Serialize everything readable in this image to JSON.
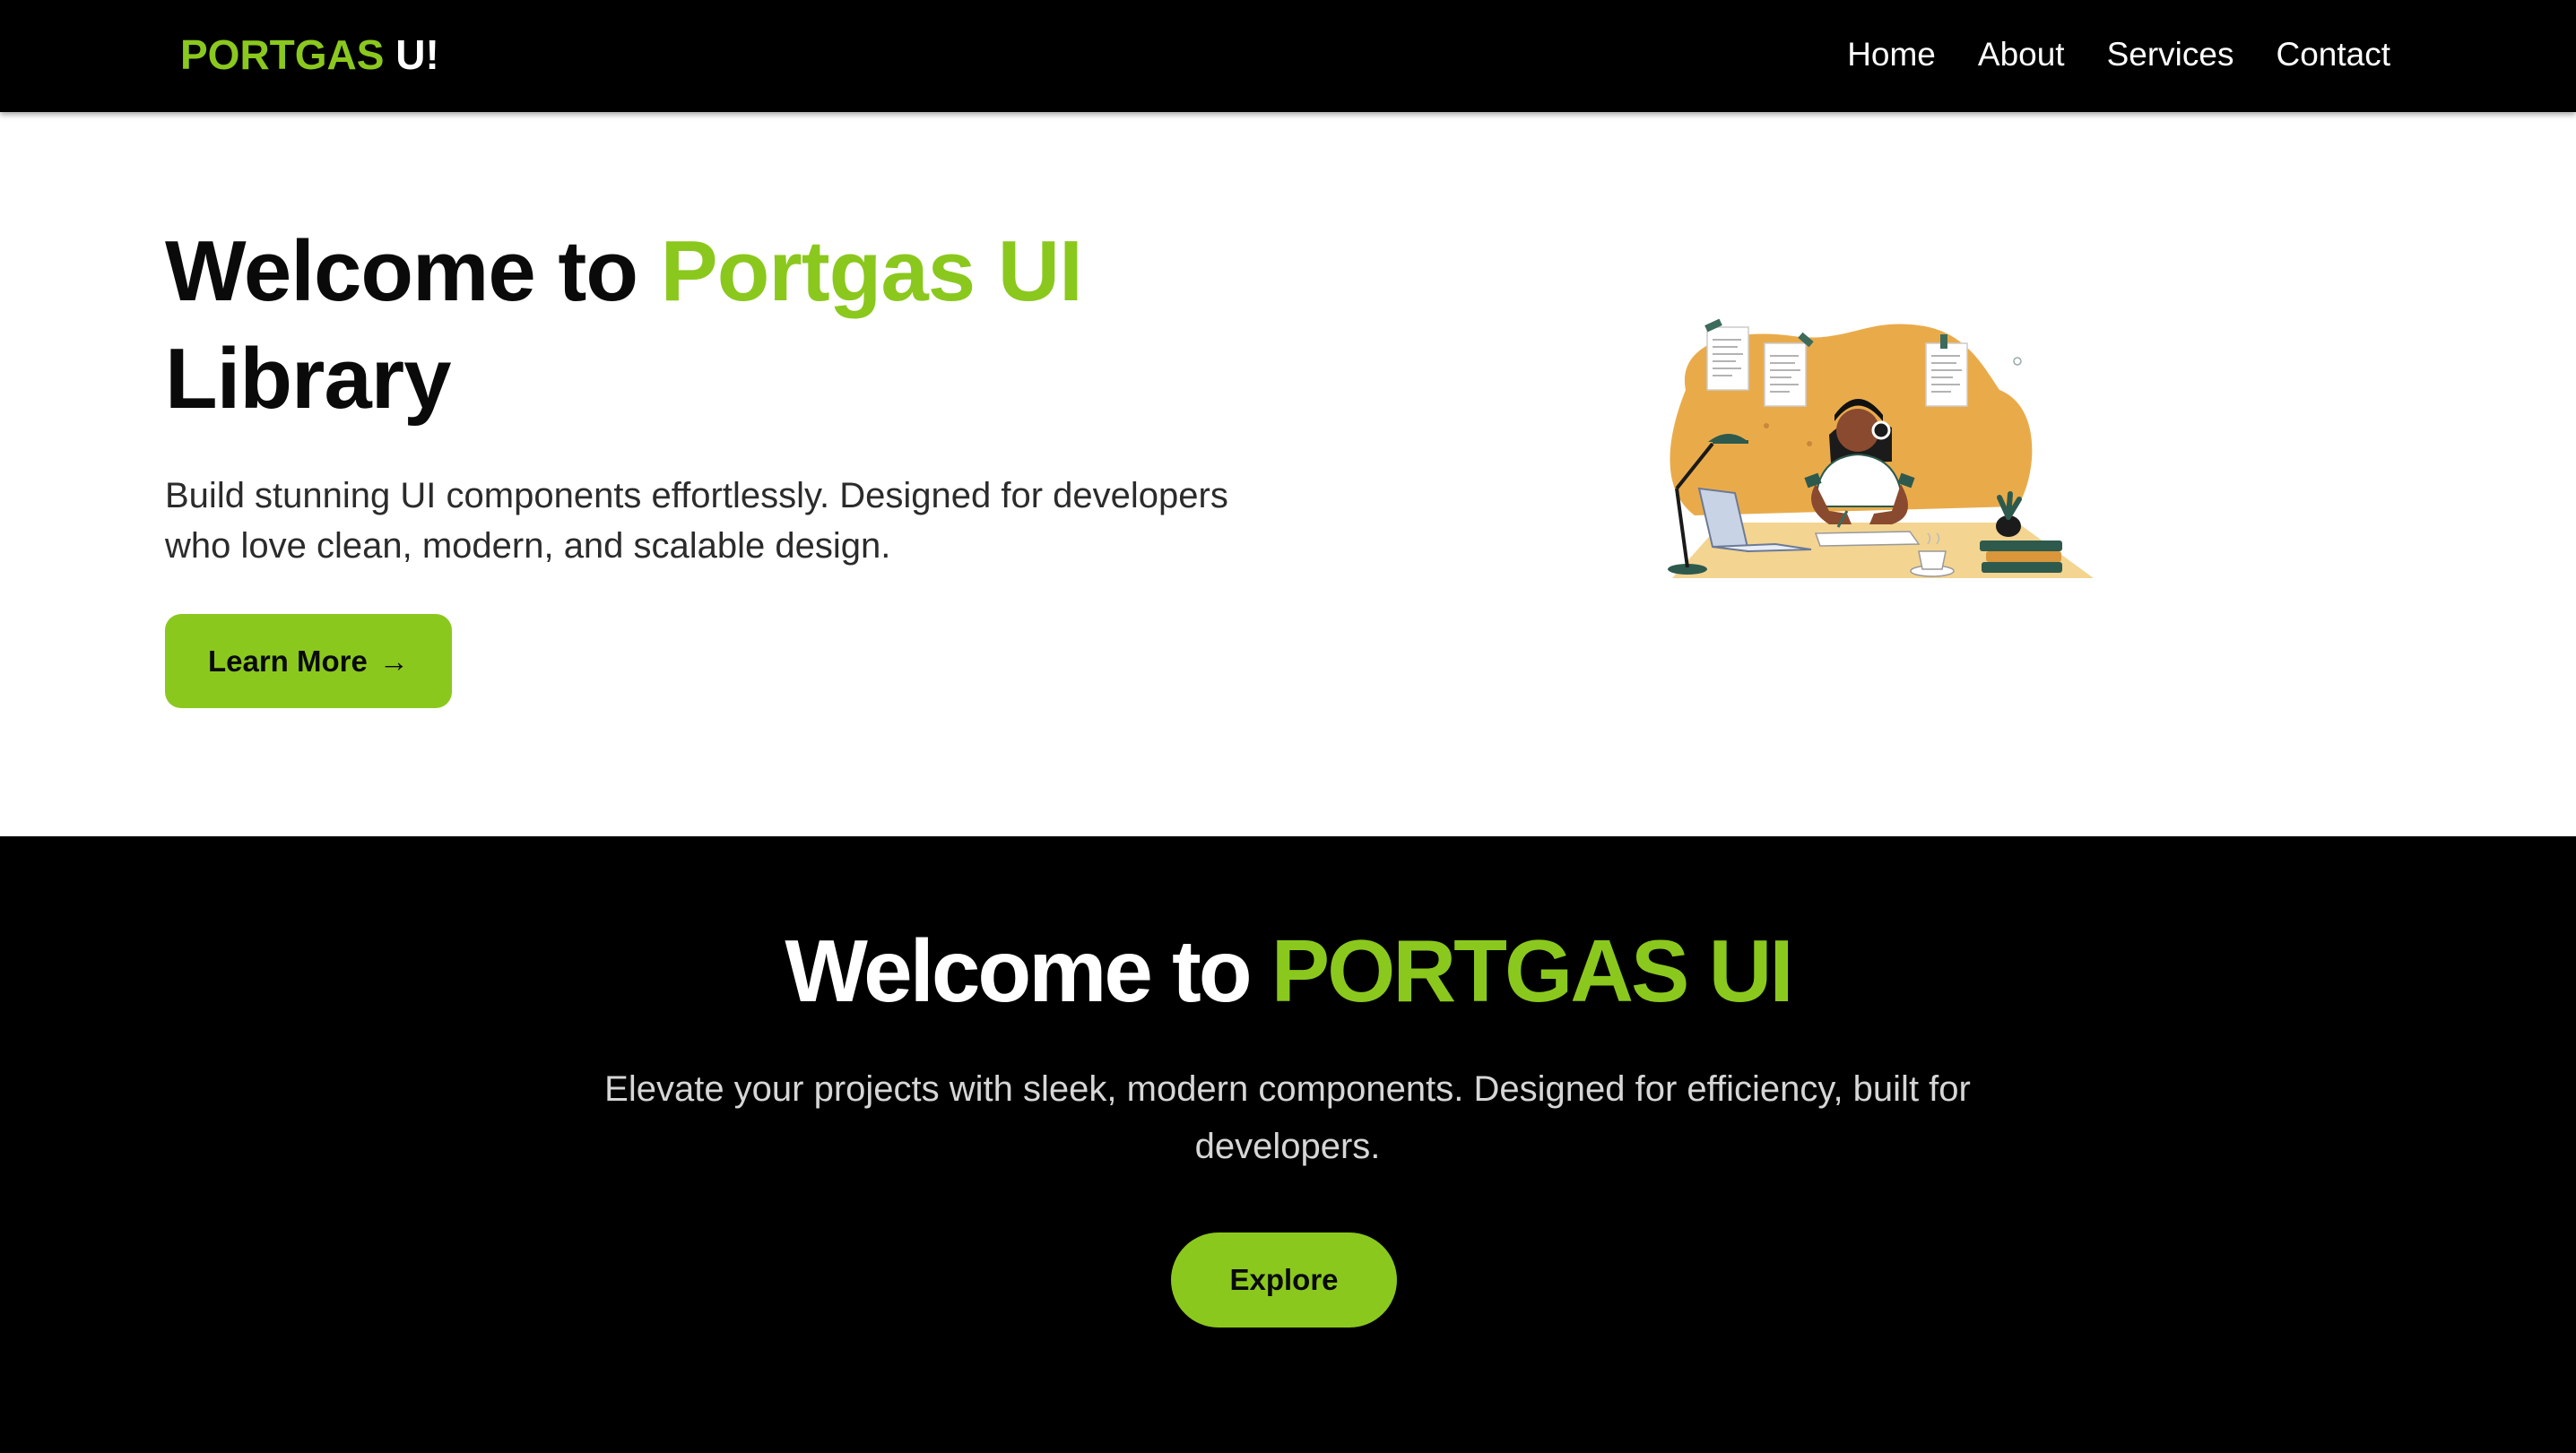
{
  "colors": {
    "accent": "#8bc81e",
    "dark_bg": "#000000",
    "light_bg": "#ffffff"
  },
  "navbar": {
    "brand_accent": "PORTGAS",
    "brand_rest": "U!",
    "links": [
      "Home",
      "About",
      "Services",
      "Contact"
    ]
  },
  "hero": {
    "title_prefix": "Welcome to",
    "title_accent": "Portgas UI",
    "title_suffix": "Library",
    "description": "Build stunning UI components effortlessly. Designed for developers who love clean, modern, and scalable design.",
    "button_label": "Learn More",
    "button_arrow": "→",
    "illustration_icon": "woman-working-at-desk-illustration"
  },
  "dark_section": {
    "title_prefix": "Welcome to",
    "title_accent": "PORTGAS UI",
    "description": "Elevate your projects with sleek, modern components. Designed for efficiency, built for developers.",
    "button_label": "Explore"
  }
}
